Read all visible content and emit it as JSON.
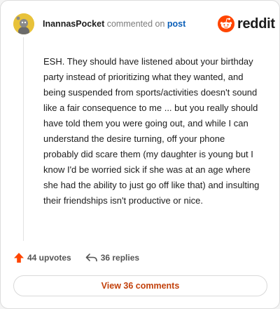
{
  "comment": {
    "username": "InannasPocket",
    "action_text": "commented on",
    "post_link": "post",
    "body": "ESH. They should have listened about your birthday party instead of prioritizing what they wanted, and being suspended from sports/activities doesn't sound like a fair consequence to me ... but you really should have told them you were going out, and while I can understand the desire turning, off your phone probably did scare them (my daughter is young but I know I'd be worried sick if she was at an age where she had the ability to just go off like that) and insulting their friendships isn't productive or nice."
  },
  "brand": {
    "name": "reddit",
    "color": "#ff4500"
  },
  "footer": {
    "upvotes": "44 upvotes",
    "replies": "36 replies",
    "view_comments": "View 36 comments"
  },
  "colors": {
    "accent": "#ff4500",
    "link": "#0b5fb8",
    "button_text": "#c2410c",
    "avatar": "#e8c23a"
  },
  "icons": [
    "avatar",
    "reddit-logo-icon",
    "upvote-icon",
    "reply-icon"
  ]
}
